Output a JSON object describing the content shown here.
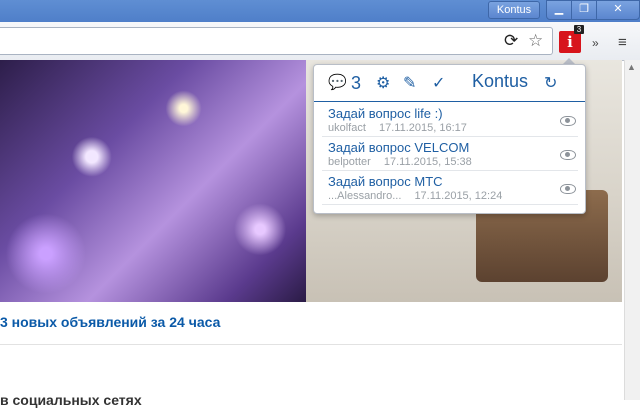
{
  "window": {
    "profile_label": "Kontus",
    "minimize_glyph": "▁",
    "maximize_glyph": "❐",
    "close_glyph": "✕"
  },
  "toolbar": {
    "reload_icon": "⟳",
    "star_icon": "☆",
    "extension_glyph": "i",
    "extension_badge": "3",
    "more_glyph": "»",
    "menu_glyph": "≡"
  },
  "page": {
    "headline": "3 новых объявлений за 24 часа",
    "subhead": "в социальных сетях"
  },
  "popup": {
    "chat_icon": "💬",
    "count": "3",
    "gear_icon": "⚙",
    "edit_icon": "✎",
    "read_all_icon": "✓",
    "title": "Kontus",
    "refresh_icon": "↻",
    "messages": [
      {
        "title": "Задай вопрос life :)",
        "author": "ukolfact",
        "date": "17.11.2015, 16:17"
      },
      {
        "title": "Задай вопрос VELCOM",
        "author": "belpotter",
        "date": "17.11.2015, 15:38"
      },
      {
        "title": "Задай вопрос МТС",
        "author": "...Alessandro...",
        "date": "17.11.2015, 12:24"
      }
    ]
  },
  "colors": {
    "accent": "#1f5fa3",
    "extension_red": "#d7141c",
    "titlebar_blue": "#5f8ed3"
  }
}
